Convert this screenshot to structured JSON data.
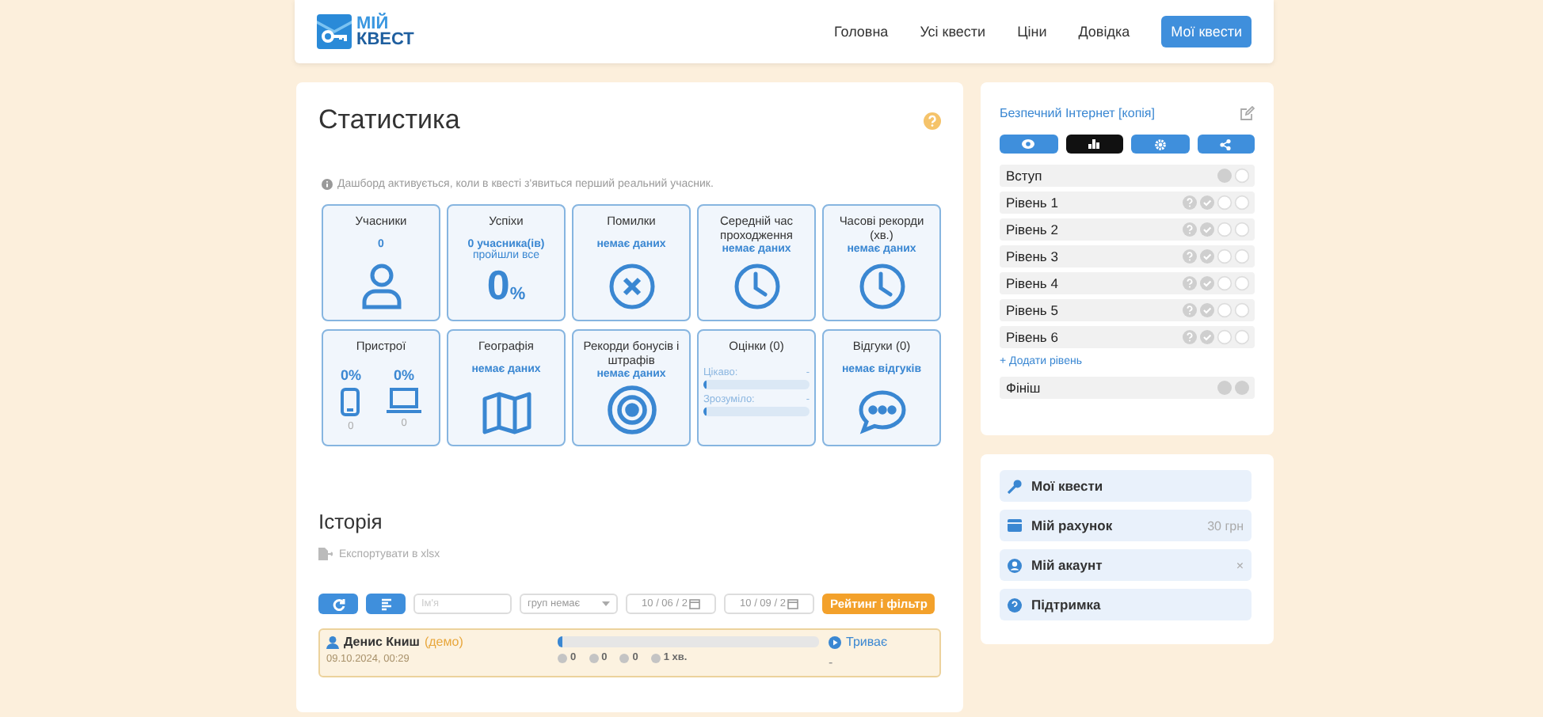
{
  "header": {
    "logo_lines": [
      "МІЙ",
      "КВЕСТ"
    ],
    "nav": [
      {
        "label": "Головна",
        "selected": false
      },
      {
        "label": "Усі квести",
        "selected": false
      },
      {
        "label": "Ціни",
        "selected": false
      },
      {
        "label": "Довідка",
        "selected": false
      },
      {
        "label": "Мої квести",
        "selected": true
      }
    ]
  },
  "stats": {
    "title": "Статистика",
    "info": "Дашборд активується, коли в квесті з'явиться перший реальний учасник.",
    "tiles": [
      {
        "kind": "person",
        "title": "Учасники",
        "value": "0"
      },
      {
        "kind": "percent",
        "title": "Успіхи",
        "value": "0 учасника(ів)",
        "note": "пройшли все",
        "percent": "0",
        "unit": "%"
      },
      {
        "kind": "error",
        "title": "Помилки",
        "value": "немає даних"
      },
      {
        "kind": "clock",
        "title": "Середній час проходження",
        "value": "немає даних"
      },
      {
        "kind": "clock",
        "title": "Часові рекорди (хв.)",
        "value": "немає даних"
      },
      {
        "kind": "devices",
        "title": "Пристрої",
        "devices": [
          {
            "share": "0%",
            "count": "0"
          },
          {
            "share": "0%",
            "count": "0"
          }
        ]
      },
      {
        "kind": "map",
        "title": "Географія",
        "value": "немає даних"
      },
      {
        "kind": "target",
        "title": "Рекорди бонусів і штрафів",
        "value": "немає даних"
      },
      {
        "kind": "ratings",
        "title": "Оцінки (0)",
        "ratings": [
          {
            "label": "Цікаво:",
            "reading": "-",
            "level": 0.02
          },
          {
            "label": "Зрозуміло:",
            "reading": "-",
            "level": 0.02
          }
        ]
      },
      {
        "kind": "chat",
        "title": "Відгуки (0)",
        "value": "немає відгуків"
      }
    ]
  },
  "history": {
    "title": "Історія",
    "export": "Експортувати в xlsx",
    "search": {
      "placeholder": "Ім'я"
    },
    "group_select": "груп немає",
    "date_from": "10 / 06 / 2",
    "date_to": "10 / 09 / 2",
    "filter_button": "Рейтинг і фільтр",
    "rows": [
      {
        "name": "Денис Книш",
        "tag": "(демо)",
        "date": "09.10.2024, 00:29",
        "level": 0.02,
        "counts": [
          "0",
          "0",
          "0",
          "1 хв."
        ],
        "status": "Триває",
        "result": "-"
      }
    ]
  },
  "quest": {
    "title": "Безпечний Інтернет [копія]",
    "tabs": [
      {
        "kind": "eye",
        "selected": false
      },
      {
        "kind": "chart",
        "selected": true
      },
      {
        "kind": "gear",
        "selected": false
      },
      {
        "kind": "share",
        "selected": false
      }
    ],
    "levels": [
      {
        "name": "Вступ",
        "marks": [
          {
            "kind": "filled"
          },
          {
            "kind": "empty"
          }
        ]
      },
      {
        "name": "Рівень 1",
        "marks": [
          {
            "kind": "help"
          },
          {
            "kind": "check"
          },
          {
            "kind": "empty"
          },
          {
            "kind": "empty"
          }
        ]
      },
      {
        "name": "Рівень 2",
        "marks": [
          {
            "kind": "help"
          },
          {
            "kind": "check"
          },
          {
            "kind": "empty"
          },
          {
            "kind": "empty"
          }
        ]
      },
      {
        "name": "Рівень 3",
        "marks": [
          {
            "kind": "help"
          },
          {
            "kind": "check"
          },
          {
            "kind": "empty"
          },
          {
            "kind": "empty"
          }
        ]
      },
      {
        "name": "Рівень 4",
        "marks": [
          {
            "kind": "help"
          },
          {
            "kind": "check"
          },
          {
            "kind": "empty"
          },
          {
            "kind": "empty"
          }
        ]
      },
      {
        "name": "Рівень 5",
        "marks": [
          {
            "kind": "help"
          },
          {
            "kind": "check"
          },
          {
            "kind": "empty"
          },
          {
            "kind": "empty"
          }
        ]
      },
      {
        "name": "Рівень 6",
        "marks": [
          {
            "kind": "help"
          },
          {
            "kind": "check"
          },
          {
            "kind": "empty"
          },
          {
            "kind": "empty"
          }
        ]
      }
    ],
    "add_level": "+ Додати рівень",
    "finish": {
      "name": "Фініш",
      "marks": [
        {
          "kind": "filled"
        },
        {
          "kind": "filled"
        }
      ]
    }
  },
  "menu": [
    {
      "kind": "key",
      "label": "Мої квести"
    },
    {
      "kind": "wallet",
      "label": "Мій рахунок",
      "extra": "30 грн"
    },
    {
      "kind": "account",
      "label": "Мій акаунт",
      "extra": "×"
    },
    {
      "kind": "help",
      "label": "Підтримка"
    }
  ]
}
